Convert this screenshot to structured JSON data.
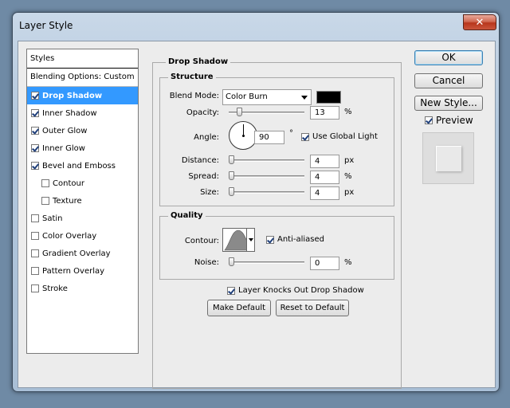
{
  "window": {
    "title": "Layer Style",
    "close_glyph": "✕"
  },
  "styles_list": {
    "header": "Styles",
    "blending_options": "Blending Options: Custom",
    "items": [
      {
        "label": "Drop Shadow",
        "checked": true,
        "selected": true,
        "sub": false
      },
      {
        "label": "Inner Shadow",
        "checked": true,
        "selected": false,
        "sub": false
      },
      {
        "label": "Outer Glow",
        "checked": true,
        "selected": false,
        "sub": false
      },
      {
        "label": "Inner Glow",
        "checked": true,
        "selected": false,
        "sub": false
      },
      {
        "label": "Bevel and Emboss",
        "checked": true,
        "selected": false,
        "sub": false
      },
      {
        "label": "Contour",
        "checked": false,
        "selected": false,
        "sub": true
      },
      {
        "label": "Texture",
        "checked": false,
        "selected": false,
        "sub": true
      },
      {
        "label": "Satin",
        "checked": false,
        "selected": false,
        "sub": false
      },
      {
        "label": "Color Overlay",
        "checked": false,
        "selected": false,
        "sub": false
      },
      {
        "label": "Gradient Overlay",
        "checked": false,
        "selected": false,
        "sub": false
      },
      {
        "label": "Pattern Overlay",
        "checked": false,
        "selected": false,
        "sub": false
      },
      {
        "label": "Stroke",
        "checked": false,
        "selected": false,
        "sub": false
      }
    ]
  },
  "drop_shadow": {
    "title": "Drop Shadow",
    "structure": {
      "title": "Structure",
      "blend_mode_label": "Blend Mode:",
      "blend_mode_value": "Color Burn",
      "shadow_color": "#000000",
      "opacity_label": "Opacity:",
      "opacity_value": "13",
      "opacity_unit": "%",
      "angle_label": "Angle:",
      "angle_value": "90",
      "angle_unit": "°",
      "use_global_light_label": "Use Global Light",
      "use_global_light": true,
      "distance_label": "Distance:",
      "distance_value": "4",
      "distance_unit": "px",
      "spread_label": "Spread:",
      "spread_value": "4",
      "spread_unit": "%",
      "size_label": "Size:",
      "size_value": "4",
      "size_unit": "px"
    },
    "quality": {
      "title": "Quality",
      "contour_label": "Contour:",
      "anti_aliased_label": "Anti-aliased",
      "anti_aliased": true,
      "noise_label": "Noise:",
      "noise_value": "0",
      "noise_unit": "%"
    },
    "knocks_out_label": "Layer Knocks Out Drop Shadow",
    "knocks_out": true,
    "make_default_label": "Make Default",
    "reset_default_label": "Reset to Default"
  },
  "actions": {
    "ok_label": "OK",
    "cancel_label": "Cancel",
    "new_style_label": "New Style...",
    "preview_label": "Preview",
    "preview_checked": true
  }
}
